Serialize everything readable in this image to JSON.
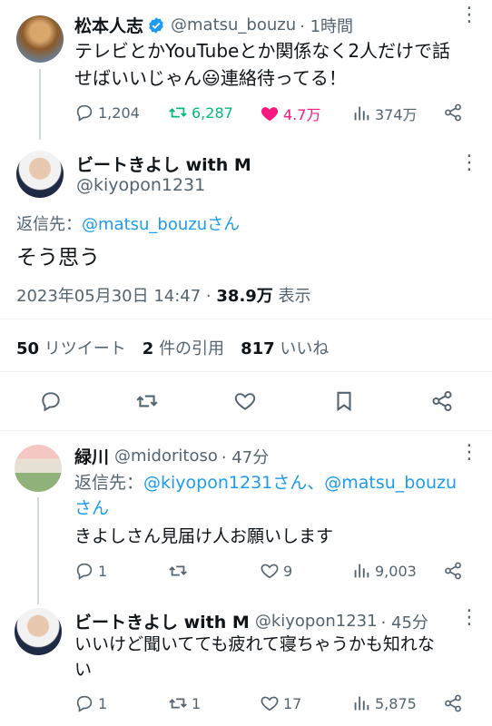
{
  "tweet1": {
    "name": "松本人志",
    "handle": "@matsu_bouzu",
    "time": "· 1時間",
    "text_line1": "テレビとかYouTubeとか関係なく2人だけで話",
    "text_line2": "せばいいじゃん",
    "text_line2b": "連絡待ってる！",
    "emoji": "😃",
    "replies": "1,204",
    "retweets": "6,287",
    "likes": "4.7万",
    "views": "374万"
  },
  "main": {
    "name": "ビートきよし with M",
    "handle": "@kiyopon1231",
    "reply_to_label": "返信先：",
    "reply_to_user": "@matsu_bouzuさん",
    "text": "そう思う",
    "timestamp": "2023年05月30日 14:47 · ",
    "views": "38.9万",
    "views_label": " 表示",
    "retweets_count": "50",
    "retweets_label": "リツイート",
    "quotes_count": "2",
    "quotes_label": "件の引用",
    "likes_count": "817",
    "likes_label": "いいね"
  },
  "reply1": {
    "name": "緑川",
    "handle": "@midoritoso",
    "time": "· 47分",
    "reply_to_label": "返信先：",
    "reply_to_users": "@kiyopon1231さん、@matsu_bouzu",
    "reply_to_tail": "さん",
    "text": "きよしさん見届け人お願いします",
    "replies": "1",
    "retweets": "",
    "likes": "9",
    "views": "9,003"
  },
  "reply2": {
    "name": "ビートきよし with M",
    "handle": "@kiyopon1231",
    "time": "· 45分",
    "text_line1": "いいけど聞いてても疲れて寝ちゃうかも知れな",
    "text_line2": "い",
    "replies": "1",
    "retweets": "1",
    "likes": "17",
    "views": "5,875"
  },
  "colors": {
    "verified": "#1d9bf0",
    "retweet_green": "#00ba7c",
    "like_pink": "#f91880",
    "text_muted": "#536471"
  }
}
